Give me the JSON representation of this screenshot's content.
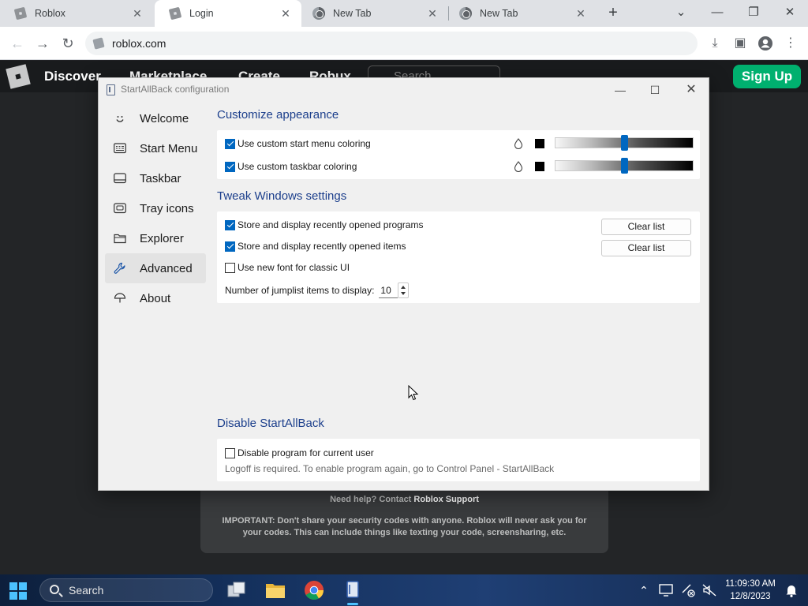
{
  "browser": {
    "tabs": [
      {
        "title": "Roblox",
        "icon": "roblox-favicon",
        "active": false
      },
      {
        "title": "Login",
        "icon": "roblox-favicon",
        "active": true
      },
      {
        "title": "New Tab",
        "icon": "chrome-favicon",
        "active": false
      },
      {
        "title": "New Tab",
        "icon": "chrome-favicon",
        "active": false
      }
    ],
    "url": "roblox.com"
  },
  "roblox_page": {
    "nav": [
      "Discover",
      "Marketplace",
      "Create",
      "Robux"
    ],
    "search_placeholder": "Search",
    "signup_label": "Sign Up",
    "help_text": "Need help? Contact",
    "help_link": "Roblox Support",
    "important_text": "IMPORTANT: Don't share your security codes with anyone. Roblox will never ask you for your codes. This can include things like texting your code, screensharing, etc."
  },
  "dialog": {
    "title": "StartAllBack configuration",
    "sidebar": [
      {
        "label": "Welcome",
        "icon": "smiley-icon",
        "active": false
      },
      {
        "label": "Start Menu",
        "icon": "start-menu-icon",
        "active": false
      },
      {
        "label": "Taskbar",
        "icon": "taskbar-icon",
        "active": false
      },
      {
        "label": "Tray icons",
        "icon": "tray-icon",
        "active": false
      },
      {
        "label": "Explorer",
        "icon": "folder-icon",
        "active": false
      },
      {
        "label": "Advanced",
        "icon": "wrench-icon",
        "active": true
      },
      {
        "label": "About",
        "icon": "umbrella-icon",
        "active": false
      }
    ],
    "customize": {
      "title": "Customize appearance",
      "start_menu_coloring": {
        "label": "Use custom start menu coloring",
        "checked": true,
        "color": "#000000",
        "slider_fraction": 0.5
      },
      "taskbar_coloring": {
        "label": "Use custom taskbar coloring",
        "checked": true,
        "color": "#000000",
        "slider_fraction": 0.5
      }
    },
    "tweak": {
      "title": "Tweak Windows settings",
      "recent_programs": {
        "label": "Store and display recently opened programs",
        "checked": true,
        "button": "Clear list"
      },
      "recent_items": {
        "label": "Store and display recently opened items",
        "checked": true,
        "button": "Clear list"
      },
      "new_font": {
        "label": "Use new font for classic UI",
        "checked": false
      },
      "jumplist": {
        "label": "Number of jumplist items to display:",
        "value": "10"
      }
    },
    "disable": {
      "title": "Disable StartAllBack",
      "checkbox": {
        "label": "Disable program for current user",
        "checked": false
      },
      "note": "Logoff is required. To enable program again, go to Control Panel - StartAllBack"
    }
  },
  "taskbar": {
    "search_label": "Search",
    "time": "11:09:30 AM",
    "date": "12/8/2023",
    "accent": "#4cc2ff"
  },
  "colors": {
    "section_title": "#1c3f8c",
    "checkbox_accent": "#0067c0",
    "roblox_green": "#00b06f"
  }
}
